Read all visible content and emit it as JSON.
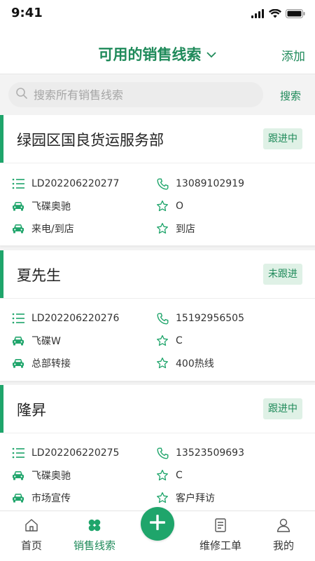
{
  "status_bar": {
    "time": "9:41"
  },
  "header": {
    "title": "可用的销售线索",
    "add_label": "添加"
  },
  "search": {
    "placeholder": "搜索所有销售线索",
    "button_label": "搜索"
  },
  "leads": [
    {
      "name": "绿园区国良货运服务部",
      "status": "跟进中",
      "id": "LD202206220277",
      "phone": "13089102919",
      "model": "飞碟奥驰",
      "level": "O",
      "source": "来电/到店",
      "visit": "到店"
    },
    {
      "name": "夏先生",
      "status": "未跟进",
      "id": "LD202206220276",
      "phone": "15192956505",
      "model": "飞碟W",
      "level": "C",
      "source": "总部转接",
      "visit": "400热线"
    },
    {
      "name": "隆昇",
      "status": "跟进中",
      "id": "LD202206220275",
      "phone": "13523509693",
      "model": "飞碟奥驰",
      "level": "C",
      "source": "市场宣传",
      "visit": "客户拜访"
    }
  ],
  "tabbar": {
    "items": [
      {
        "label": "首页",
        "icon": "home-icon"
      },
      {
        "label": "销售线索",
        "icon": "clover-icon"
      },
      {
        "label": "维修工单",
        "icon": "document-icon"
      },
      {
        "label": "我的",
        "icon": "person-icon"
      }
    ],
    "fab_icon": "plus-icon"
  },
  "colors": {
    "accent": "#1fa56b",
    "accent_text": "#1f8a5a",
    "badge_bg": "#dff1e6"
  }
}
